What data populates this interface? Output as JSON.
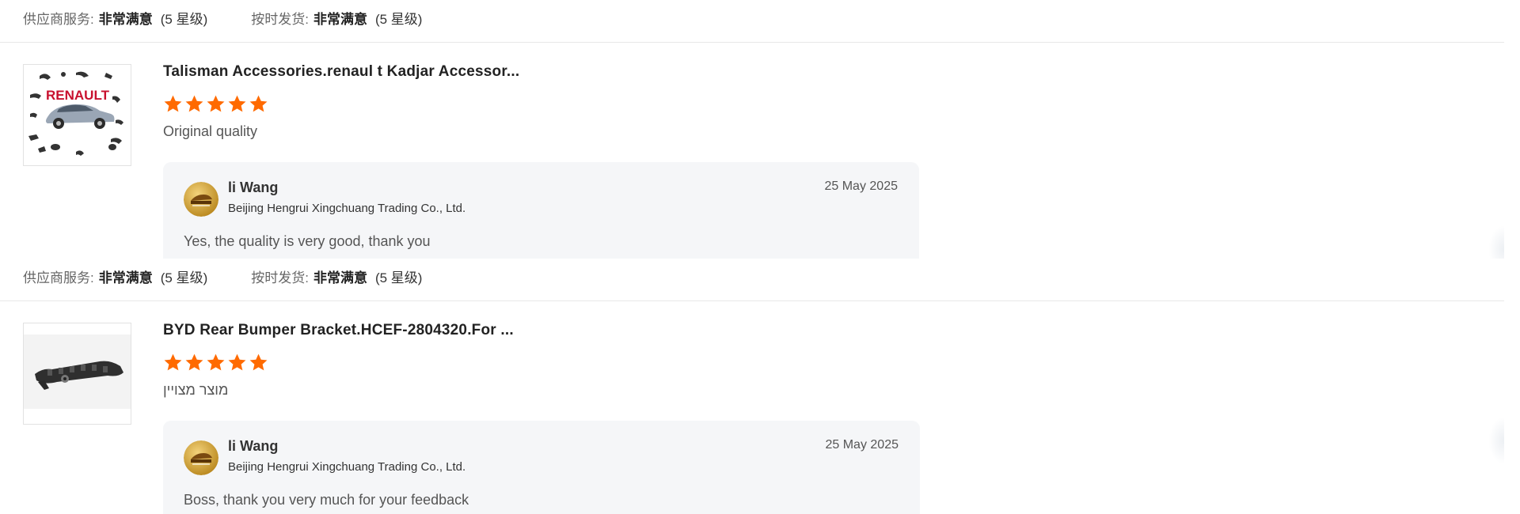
{
  "reviews": [
    {
      "supplier_service_label": "供应商服务:",
      "supplier_service_value": "非常满意",
      "supplier_service_level": "(5 星级)",
      "on_time_label": "按时发货:",
      "on_time_value": "非常满意",
      "on_time_level": "(5 星级)",
      "product_title": "Talisman Accessories.renaul t Kadjar Accessor...",
      "stars": 5,
      "review_text": "Original quality",
      "thumbnail_icon": "renault-accessories-image",
      "thumbnail_brand_text": "RENAULT",
      "reply": {
        "name": "li Wang",
        "company": "Beijing Hengrui Xingchuang Trading Co., Ltd.",
        "date": "25 May 2025",
        "text": "Yes, the quality is very good, thank you"
      }
    },
    {
      "supplier_service_label": "供应商服务:",
      "supplier_service_value": "非常满意",
      "supplier_service_level": "(5 星级)",
      "on_time_label": "按时发货:",
      "on_time_value": "非常满意",
      "on_time_level": "(5 星级)",
      "product_title": "BYD Rear Bumper Bracket.HCEF-2804320.For ...",
      "stars": 5,
      "review_text": "מוצר מצויין",
      "thumbnail_icon": "bumper-bracket-image",
      "reply": {
        "name": "li Wang",
        "company": "Beijing Hengrui Xingchuang Trading Co., Ltd.",
        "date": "25 May 2025",
        "text": "Boss, thank you very much for your feedback"
      }
    }
  ],
  "colors": {
    "star": "#ff6a00",
    "reply_bg": "#f5f6f8",
    "divider": "#e8e8e8"
  }
}
